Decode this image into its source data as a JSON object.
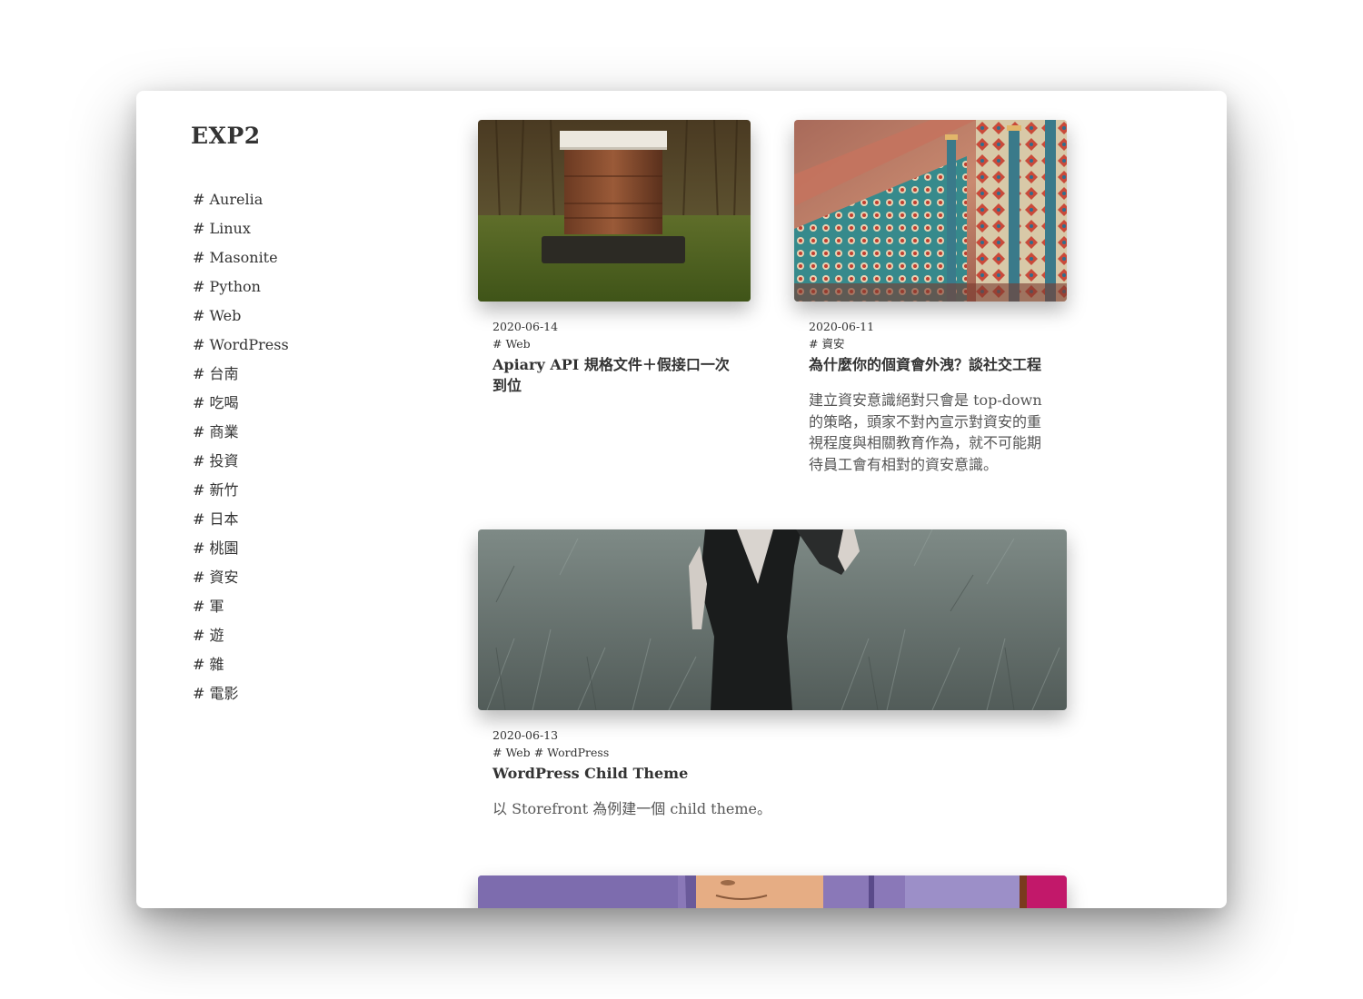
{
  "site": {
    "title": "EXP2"
  },
  "sidebar": {
    "tags": [
      "# Aurelia",
      "# Linux",
      "# Masonite",
      "# Python",
      "# Web",
      "# WordPress",
      "# 台南",
      "# 吃喝",
      "# 商業",
      "# 投資",
      "# 新竹",
      "# 日本",
      "# 桃園",
      "# 資安",
      "# 軍",
      "# 遊",
      "# 雜",
      "# 電影"
    ]
  },
  "posts": [
    {
      "date": "2020-06-14",
      "tags": [
        "# Web"
      ],
      "title": "Apiary API 規格文件＋假接口一次到位",
      "excerpt": "",
      "image": "beehive-photo"
    },
    {
      "date": "2020-06-11",
      "tags": [
        "# 資安"
      ],
      "title": "為什麼你的個資會外洩？談社交工程",
      "excerpt": "建立資安意識絕對只會是 top-down 的策略，頭家不對內宣示對資安的重視程度與相關教育作為，就不可能期待員工會有相對的資安意識。",
      "image": "ornate-tiles-photo"
    },
    {
      "date": "2020-06-13",
      "tags": [
        "# Web",
        "# WordPress"
      ],
      "title": "WordPress Child Theme",
      "excerpt": "以 Storefront 為例建一個 child theme。",
      "image": "woman-in-grass-photo"
    },
    {
      "image": "cartoon-photo"
    }
  ],
  "colors": {
    "text": "#333333",
    "excerpt": "#555555",
    "background": "#ffffff"
  }
}
